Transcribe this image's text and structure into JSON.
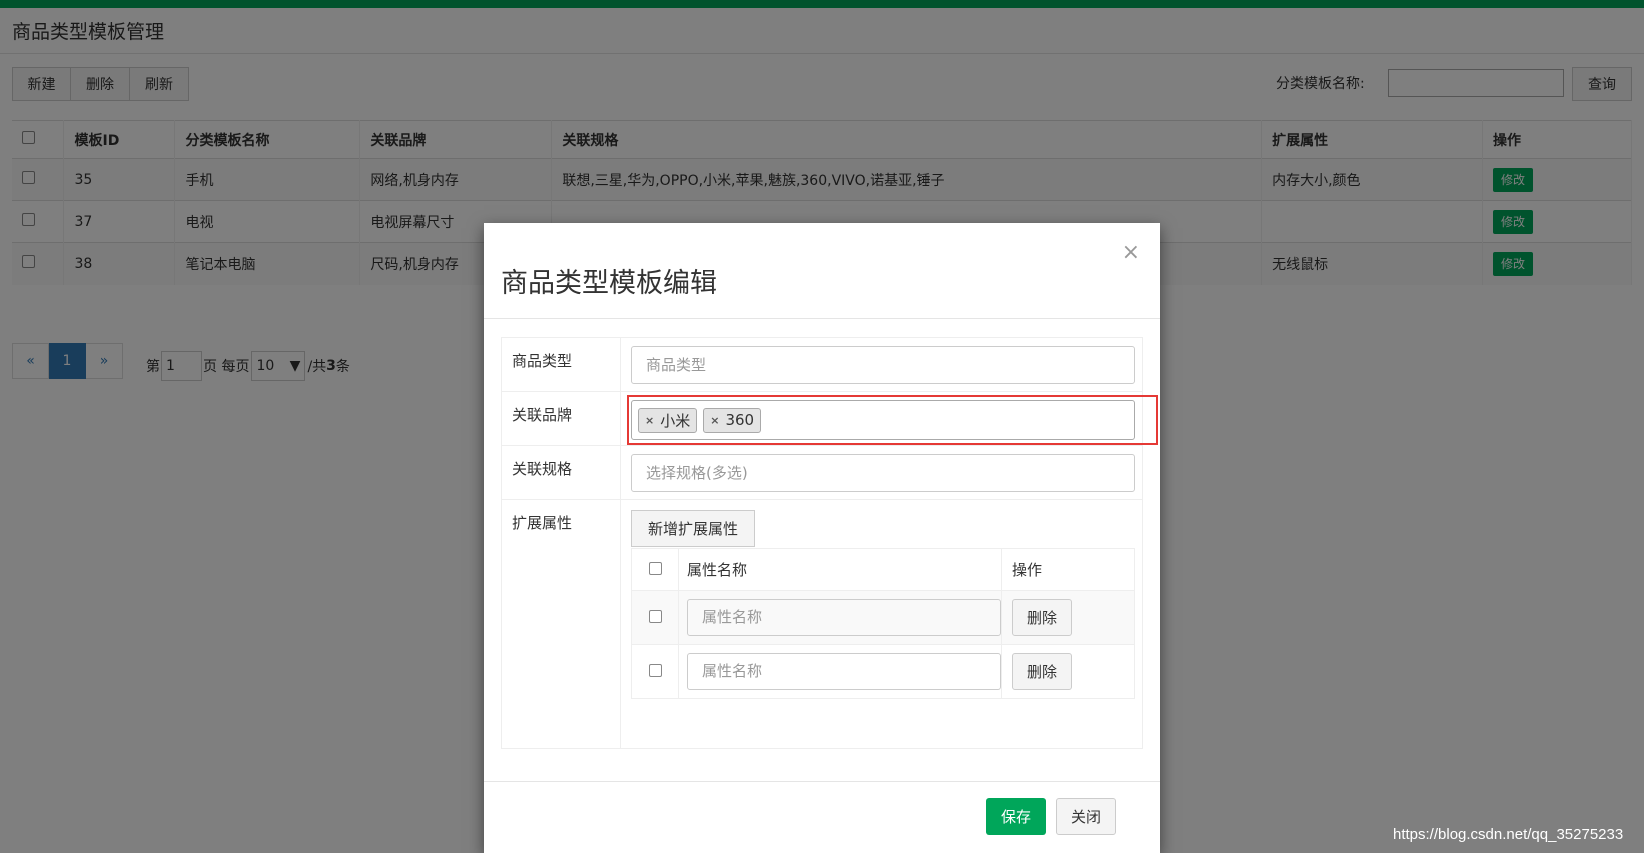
{
  "page": {
    "title": "商品类型模板管理",
    "toolbar": {
      "new_label": "新建",
      "delete_label": "删除",
      "refresh_label": "刷新"
    },
    "search": {
      "label": "分类模板名称:",
      "value": "",
      "button_label": "查询"
    }
  },
  "table": {
    "headers": [
      "模板ID",
      "分类模板名称",
      "关联品牌",
      "关联规格",
      "扩展属性",
      "操作"
    ],
    "rows": [
      {
        "id": "35",
        "name": "手机",
        "brands": "网络,机身内存",
        "specs": "联想,三星,华为,OPPO,小米,苹果,魅族,360,VIVO,诺基亚,锤子",
        "ext": "内存大小,颜色",
        "action": "修改"
      },
      {
        "id": "37",
        "name": "电视",
        "brands": "电视屏幕尺寸",
        "specs": "",
        "ext": "",
        "action": "修改"
      },
      {
        "id": "38",
        "name": "笔记本电脑",
        "brands": "尺码,机身内存",
        "specs": "",
        "ext": "无线鼠标",
        "action": "修改"
      }
    ]
  },
  "pager": {
    "prev": "«",
    "current": "1",
    "next": "»",
    "page_prefix": "第",
    "page_value": "1",
    "page_suffix": "页 每页",
    "page_size": "10",
    "total_prefix": "/共",
    "total": "3",
    "total_suffix": "条"
  },
  "modal": {
    "close_symbol": "×",
    "title": "商品类型模板编辑",
    "type_label": "商品类型",
    "type_placeholder": "商品类型",
    "brand_label": "关联品牌",
    "brand_tags": [
      "小米",
      "360"
    ],
    "tag_remove_symbol": "×",
    "spec_label": "关联规格",
    "spec_placeholder": "选择规格(多选)",
    "ext_label": "扩展属性",
    "add_ext_button": "新增扩展属性",
    "attr_headers": [
      "属性名称",
      "操作"
    ],
    "attr_rows": [
      {
        "placeholder": "属性名称",
        "delete_label": "删除"
      },
      {
        "placeholder": "属性名称",
        "delete_label": "删除"
      }
    ],
    "save_label": "保存",
    "close_label": "关闭"
  },
  "watermark": "https://blog.csdn.net/qq_35275233",
  "colors": {
    "accent": "#00a65a",
    "highlight": "#e53935",
    "pager_active": "#337ab7"
  }
}
